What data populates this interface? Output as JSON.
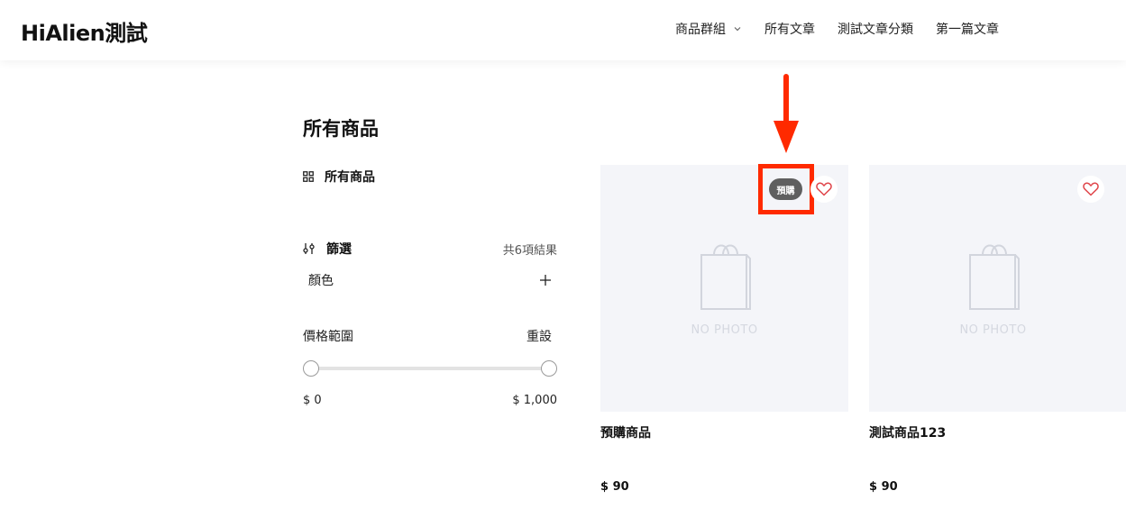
{
  "header": {
    "logo": "HiAlien測試",
    "nav": [
      {
        "label": "商品群組",
        "has_dropdown": true
      },
      {
        "label": "所有文章"
      },
      {
        "label": "測試文章分類"
      },
      {
        "label": "第一篇文章"
      }
    ]
  },
  "sidebar": {
    "page_title": "所有商品",
    "category": "所有商品",
    "filter_label": "篩選",
    "result_count": "共6項結果",
    "color_label": "顏色",
    "price_range_label": "價格範圍",
    "reset_label": "重設",
    "price_min": "$ 0",
    "price_max": "$ 1,000"
  },
  "products": [
    {
      "name": "預購商品",
      "price": "$ 90",
      "badge": "預購",
      "image_text": "NO PHOTO"
    },
    {
      "name": "測試商品123",
      "price": "$ 90",
      "image_text": "NO PHOTO"
    }
  ],
  "colors": {
    "highlight": "#ff2a00",
    "badge_bg": "#5f5f5f",
    "heart": "#e0474c",
    "image_bg": "#f4f5f9"
  }
}
